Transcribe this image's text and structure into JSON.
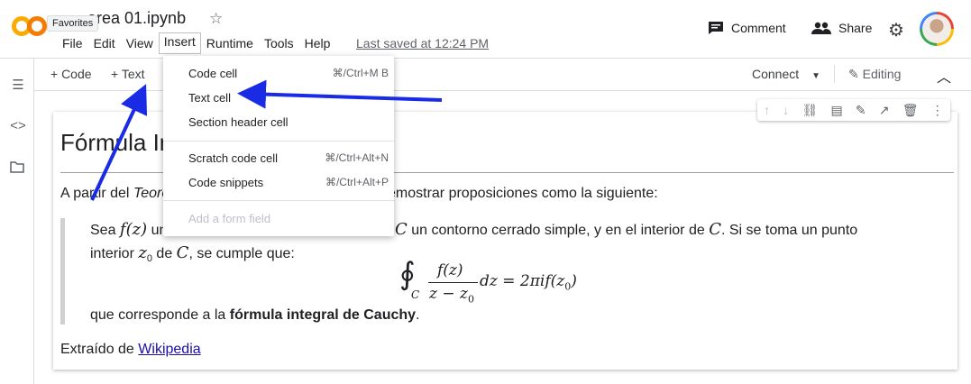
{
  "header": {
    "tooltip": "Favorites",
    "title": "tarea_01.ipynb",
    "title_visible": "area  01.ipynb",
    "last_saved": "Last saved at 12:24 PM",
    "comment_label": "Comment",
    "share_label": "Share",
    "menu": [
      "File",
      "Edit",
      "View",
      "Insert",
      "Runtime",
      "Tools",
      "Help"
    ]
  },
  "toolbar": {
    "add_code": "+ Code",
    "add_text": "+ Text",
    "connect": "Connect",
    "editing": "Editing"
  },
  "insert_menu": {
    "items": [
      {
        "label": "Code cell",
        "shortcut": "⌘/Ctrl+M B"
      },
      {
        "label": "Text cell",
        "shortcut": ""
      },
      {
        "label": "Section header cell",
        "shortcut": ""
      },
      {
        "label": "Scratch code cell",
        "shortcut": "⌘/Ctrl+Alt+N"
      },
      {
        "label": "Code snippets",
        "shortcut": "⌘/Ctrl+Alt+P"
      },
      {
        "label": "Add a form field",
        "shortcut": ""
      }
    ]
  },
  "cell": {
    "heading": "Fórmula In",
    "intro_a": "A partir del ",
    "intro_italic": "Teore",
    "intro_b": "emostrar proposiciones como la siguiente:",
    "quote_l1a": "Sea ",
    "quote_fz": "f(z)",
    "quote_l1b": " un",
    "quote_C": "C",
    "quote_l1c": " un contorno cerrado simple, y en el interior de ",
    "quote_C2": "C",
    "quote_l1d": ". Si se toma un punto",
    "quote_l2a": "interior ",
    "quote_z0": "z",
    "quote_z0_sub": "0",
    "quote_l2b": " de ",
    "quote_C3": "C",
    "quote_l2c": ", se cumple que:",
    "formula_num": "f(z)",
    "formula_den": "z − z",
    "formula_den_sub": "0",
    "formula_tail": "dz = 2πif(z",
    "formula_tail_sub": "0",
    "formula_tail_end": ")",
    "formula_contour_sub": "C",
    "quote_l3a": "que corresponde a la ",
    "quote_l3b": "fórmula integral de Cauchy",
    "quote_l3c": ".",
    "source_a": "Extraído de ",
    "source_link": "Wikipedia"
  },
  "colors": {
    "arrow": "#1a2be6",
    "accent_orange": "#f9ab00"
  }
}
